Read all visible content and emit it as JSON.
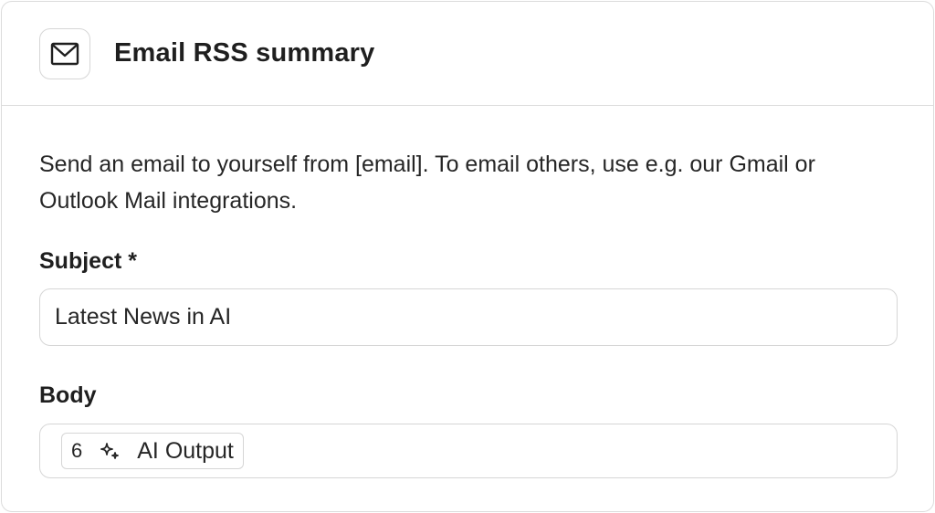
{
  "header": {
    "icon": "mail-icon",
    "title": "Email RSS summary"
  },
  "description": "Send an email to yourself from [email]. To email others, use e.g. our Gmail or Outlook Mail integrations.",
  "subject": {
    "label": "Subject *",
    "value": "Latest News in AI"
  },
  "body": {
    "label": "Body",
    "chip": {
      "step": "6",
      "icon": "sparkle-icon",
      "label": "AI Output"
    }
  },
  "colors": {
    "border": "#dcdcdc",
    "text": "#1f1f1f"
  }
}
